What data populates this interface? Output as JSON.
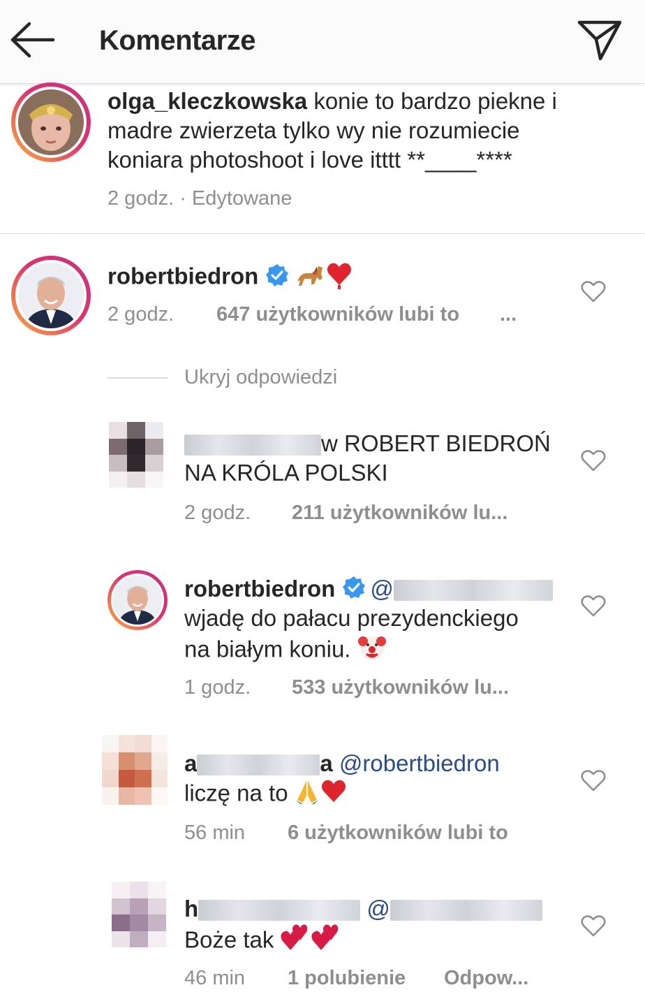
{
  "header": {
    "title": "Komentarze",
    "back_icon": "arrow-left-icon",
    "share_icon": "paper-plane-icon"
  },
  "caption": {
    "username": "olga_kleczkowska",
    "text_line1": "konie to bardzo piekne i",
    "text_line2": "madre zwierzeta tylko wy nie rozumiecie",
    "text_line3": "koniara photoshoot i love itttt **____****",
    "time": "2 godz.",
    "edited": "· Edytowane"
  },
  "comments": [
    {
      "username": "robertbiedron",
      "text": "🐎❤️",
      "time": "2 godz.",
      "likes": "647 użytkowników lubi to",
      "more": "..."
    }
  ],
  "hide_replies": "Ukryj odpowiedzi",
  "replies": [
    {
      "username_suffix": "w",
      "text_line1": "ROBERT BIEDROŃ",
      "text_line2": "NA KRÓLA POLSKI",
      "time": "2 godz.",
      "likes": "211 użytkowników lu..."
    },
    {
      "username": "robertbiedron",
      "mention_prefix": "@",
      "text_line1": "wjadę do pałacu prezydenckiego",
      "text_line2": "na białym koniu.",
      "time": "1 godz.",
      "likes": "533 użytkowników lu..."
    },
    {
      "username_prefix": "a",
      "username_suffix": "a",
      "mention": "@robertbiedron",
      "text": "liczę na to",
      "time": "56 min",
      "likes": "6 użytkowników lubi to"
    },
    {
      "username_prefix": "h",
      "mention_prefix": "@",
      "text": "Boże tak",
      "time": "46 min",
      "likes": "1 polubienie",
      "reply": "Odpow..."
    }
  ],
  "colors": {
    "text": "#262626",
    "meta": "#8e8e8e",
    "verified": "#3897f0",
    "mention": "#2a4a8a",
    "divider": "#dbdbdb"
  }
}
